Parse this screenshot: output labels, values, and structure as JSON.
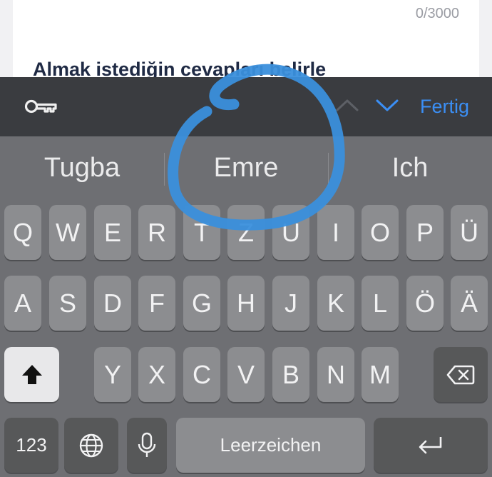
{
  "form": {
    "counter": "0/3000",
    "section_title": "Almak istediğin cevapları belirle"
  },
  "toolbar": {
    "password_icon": "key-icon",
    "prev_icon": "chevron-up-icon",
    "next_icon": "chevron-down-icon",
    "done_label": "Fertig",
    "accent": "#3b8ff5"
  },
  "suggestions": [
    "Tugba",
    "Emre",
    "Ich"
  ],
  "keyboard": {
    "row1": [
      "Q",
      "W",
      "E",
      "R",
      "T",
      "Z",
      "U",
      "I",
      "O",
      "P",
      "Ü"
    ],
    "row2": [
      "A",
      "S",
      "D",
      "F",
      "G",
      "H",
      "J",
      "K",
      "L",
      "Ö",
      "Ä"
    ],
    "row3": [
      "Y",
      "X",
      "C",
      "V",
      "B",
      "N",
      "M"
    ],
    "numbers_label": "123",
    "space_label": "Leerzeichen",
    "shift_icon": "shift-icon",
    "delete_icon": "delete-icon",
    "globe_icon": "globe-icon",
    "mic_icon": "microphone-icon",
    "return_icon": "return-icon"
  },
  "annotation": {
    "color": "#3a8fdc",
    "shape": "circle-around-suggestion"
  }
}
